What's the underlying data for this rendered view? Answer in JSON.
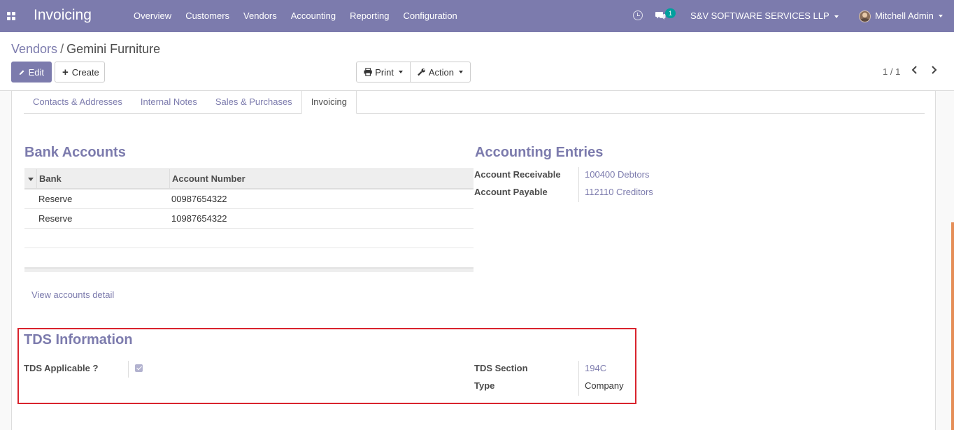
{
  "navbar": {
    "app_title": "Invoicing",
    "menu": [
      "Overview",
      "Customers",
      "Vendors",
      "Accounting",
      "Reporting",
      "Configuration"
    ],
    "chat_count": "1",
    "company": "S&V SOFTWARE SERVICES LLP",
    "user": "Mitchell Admin",
    "color": "#7c7bad"
  },
  "breadcrumb": {
    "parent": "Vendors",
    "separator": "/",
    "current": "Gemini Furniture"
  },
  "toolbar": {
    "edit": "Edit",
    "create": "Create",
    "print": "Print",
    "action": "Action"
  },
  "pager": {
    "text": "1 / 1"
  },
  "tabs": [
    {
      "label": "Contacts & Addresses",
      "active": false
    },
    {
      "label": "Internal Notes",
      "active": false
    },
    {
      "label": "Sales & Purchases",
      "active": false
    },
    {
      "label": "Invoicing",
      "active": true
    }
  ],
  "bank_accounts": {
    "title": "Bank Accounts",
    "columns": [
      "Bank",
      "Account Number"
    ],
    "rows": [
      {
        "bank": "Reserve",
        "account": "00987654322"
      },
      {
        "bank": "Reserve",
        "account": "10987654322"
      }
    ],
    "view_detail": "View accounts detail"
  },
  "accounting_entries": {
    "title": "Accounting Entries",
    "receivable_label": "Account Receivable",
    "receivable_value": "100400 Debtors",
    "payable_label": "Account Payable",
    "payable_value": "112110 Creditors"
  },
  "tds": {
    "title": "TDS Information",
    "applicable_label": "TDS Applicable ?",
    "applicable_checked": true,
    "section_label": "TDS Section",
    "section_value": "194C",
    "type_label": "Type",
    "type_value": "Company",
    "highlight_color": "#d9232d"
  }
}
